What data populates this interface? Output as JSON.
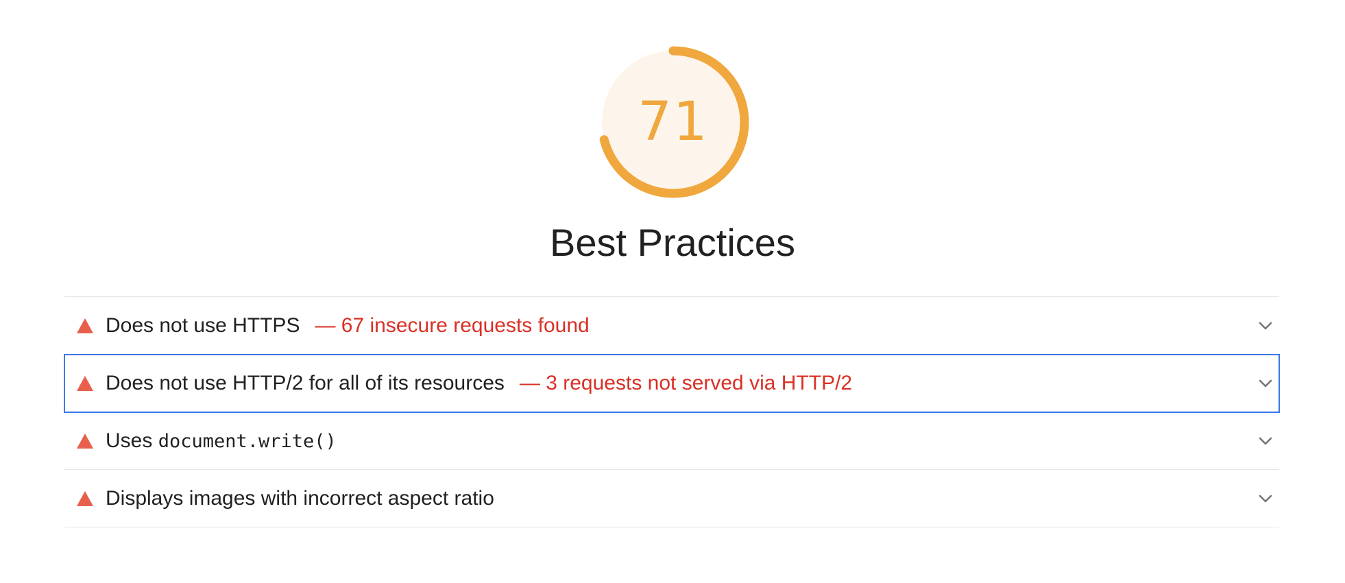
{
  "category": {
    "score": "71",
    "score_fraction": 0.71,
    "title": "Best Practices",
    "score_color": "#f0a73d",
    "gauge_bg_color": "#fdf5ec"
  },
  "audits": [
    {
      "title": "Does not use HTTPS",
      "display_value": "— 67 insecure requests found",
      "status_icon": "warning-triangle-icon",
      "focused": false
    },
    {
      "title": "Does not use HTTP/2 for all of its resources",
      "display_value": "— 3 requests not served via HTTP/2",
      "status_icon": "warning-triangle-icon",
      "focused": true
    },
    {
      "title_prefix": "Uses ",
      "title_code": "document.write()",
      "status_icon": "warning-triangle-icon",
      "focused": false
    },
    {
      "title": "Displays images with incorrect aspect ratio",
      "status_icon": "warning-triangle-icon",
      "focused": false
    }
  ],
  "colors": {
    "fail": "#e8604c",
    "fail_text": "#d93025",
    "focus_outline": "#3b78e7",
    "divider": "#e6e6e6",
    "chevron": "#757575"
  }
}
